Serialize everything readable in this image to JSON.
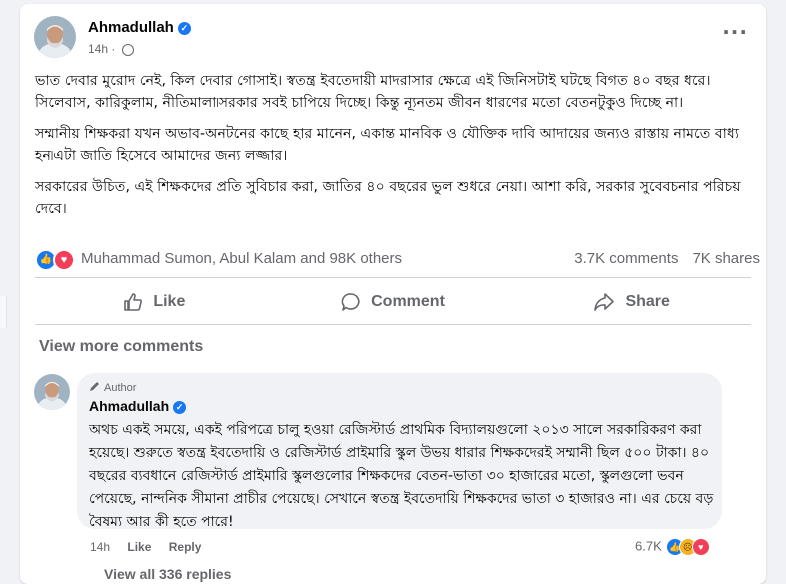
{
  "post": {
    "author": "Ahmadullah",
    "time": "14h",
    "paragraphs": [
      "ভাত দেবার মুরোদ নেই, কিল দেবার গোসাই। স্বতন্ত্র ইবতেদায়ী মাদরাসার ক্ষেত্রে এই জিনিসটাই ঘটছে বিগত ৪০ বছর ধরে। সিলেবাস, কারিকুলাম, নীতিমালা৷সরকার সবই চাপিয়ে দিচ্ছে। কিন্তু ন্যূনতম জীবন ধারণের মতো বেতনটুকুও দিচ্ছে না।",
      "সম্মানীয় শিক্ষকরা যখন অভাব-অনটনের কাছে হার মানেন, একান্ত মানবিক ও যৌক্তিক দাবি আদায়ের জন্যও রাস্তায় নামতে বাধ্য হন৷এটা জাতি হিসেবে আমাদের জন্য লজ্জার।",
      "সরকারের উচিত, এই শিক্ষকদের প্রতি সুবিচার করা, জাতির ৪০ বছরের ভুল শুধরে নেয়া। আশা করি, সরকার সুবেবচনার পরিচয় দেবে।"
    ],
    "reactors": "Muhammad Sumon, Abul Kalam and 98K others",
    "comments_count": "3.7K comments",
    "shares_count": "7K shares",
    "actions": {
      "like": "Like",
      "comment": "Comment",
      "share": "Share"
    }
  },
  "comments": {
    "view_more": "View more comments",
    "items": [
      {
        "badge": "Author",
        "author": "Ahmadullah",
        "text": "অথচ একই সময়ে, একই পরিপত্রে চালু হওয়া রেজিস্টার্ড প্রাথমিক বিদ্যালয়গুলো ২০১৩ সালে সরকারিকরণ করা হয়েছে। শুরুতে স্বতন্ত্র ইবতেদায়ি ও রেজিস্টার্ড প্রাইমারি স্কুল উভয় ধারার শিক্ষকদেরই সম্মানী ছিল ৫০০ টাকা। ৪০ বছরের ব্যবধানে রেজিস্টার্ড প্রাইমারি স্কুলগুলোর শিক্ষকদের বেতন-ভাতা ৩০ হাজারের মতো, স্কুলগুলো ভবন পেয়েছে, নান্দনিক সীমানা প্রাচীর পেয়েছে। সেখানে স্বতন্ত্র ইবতেদায়ি শিক্ষকদের ভাতা ৩ হাজারও না। এর চেয়ে বড় বৈষম্য আর কী হতে পারে!",
        "time": "14h",
        "like_label": "Like",
        "reply_label": "Reply",
        "reaction_count": "6.7K"
      }
    ],
    "partial_text": "View all 336 replies"
  },
  "colors": {
    "accent": "#1877f2",
    "love": "#f33e58",
    "muted": "#65676b"
  }
}
